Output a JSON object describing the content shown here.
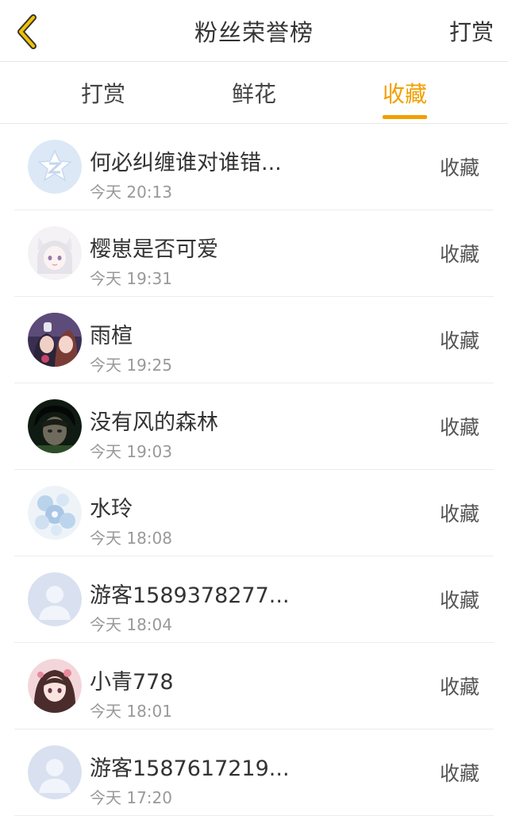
{
  "header": {
    "title": "粉丝荣誉榜",
    "right_link": "打赏",
    "back_icon": "chevron-left-icon",
    "accent_color": "#f0a000"
  },
  "tabs": [
    {
      "label": "打赏",
      "active": false
    },
    {
      "label": "鲜花",
      "active": false
    },
    {
      "label": "收藏",
      "active": true
    }
  ],
  "fans": [
    {
      "name": "何必纠缠谁对谁错...",
      "time": "今天 20:13",
      "action": "收藏",
      "avatar": "qq-logo-avatar"
    },
    {
      "name": "樱崽是否可爱",
      "time": "今天 19:31",
      "action": "收藏",
      "avatar": "anime-fox-girl-avatar"
    },
    {
      "name": "雨楦",
      "time": "今天 19:25",
      "action": "收藏",
      "avatar": "anime-couple-avatar"
    },
    {
      "name": "没有风的森林",
      "time": "今天 19:03",
      "action": "收藏",
      "avatar": "portrait-boy-avatar"
    },
    {
      "name": "水玲",
      "time": "今天 18:08",
      "action": "收藏",
      "avatar": "blue-flowers-avatar"
    },
    {
      "name": "游客1589378277...",
      "time": "今天 18:04",
      "action": "收藏",
      "avatar": "default-user-avatar"
    },
    {
      "name": "小青778",
      "time": "今天 18:01",
      "action": "收藏",
      "avatar": "anime-girl-pink-avatar"
    },
    {
      "name": "游客1587617219...",
      "time": "今天 17:20",
      "action": "收藏",
      "avatar": "default-user-avatar"
    }
  ]
}
